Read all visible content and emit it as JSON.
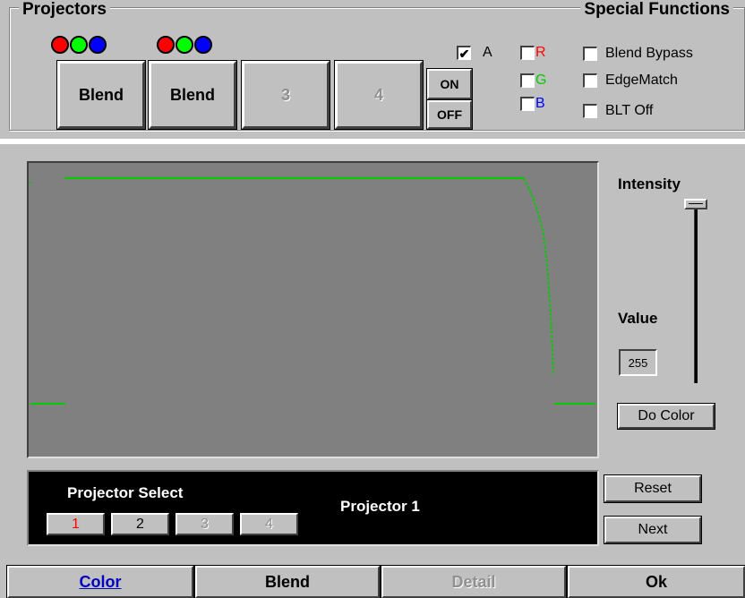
{
  "projectors_group": {
    "title": "Projectors",
    "projectors": [
      {
        "label": "Blend",
        "enabled": true,
        "has_rgb": true
      },
      {
        "label": "Blend",
        "enabled": true,
        "has_rgb": true
      },
      {
        "label": "3",
        "enabled": false,
        "has_rgb": false
      },
      {
        "label": "4",
        "enabled": false,
        "has_rgb": false
      }
    ],
    "on_label": "ON",
    "off_label": "OFF",
    "channels": {
      "a": {
        "label": "A",
        "checked": true
      },
      "r": {
        "label": "R",
        "checked": false,
        "color": "#ff0000"
      },
      "g": {
        "label": "G",
        "checked": false,
        "color": "#00cc00"
      },
      "b": {
        "label": "B",
        "checked": false,
        "color": "#0000ff"
      }
    }
  },
  "special_functions": {
    "title": "Special Functions",
    "options": [
      {
        "label": "Blend Bypass",
        "checked": false
      },
      {
        "label": "EdgeMatch",
        "checked": false
      },
      {
        "label": "BLT Off",
        "checked": false
      }
    ]
  },
  "intensity": {
    "title": "Intensity",
    "value_label": "Value",
    "value": "255",
    "slider_level": 1.0,
    "do_color_label": "Do Color"
  },
  "projector_select": {
    "title": "Projector Select",
    "buttons": [
      {
        "label": "1",
        "enabled": true,
        "selected": true
      },
      {
        "label": "2",
        "enabled": true,
        "selected": false
      },
      {
        "label": "3",
        "enabled": false,
        "selected": false
      },
      {
        "label": "4",
        "enabled": false,
        "selected": false
      }
    ],
    "current": "Projector 1"
  },
  "actions": {
    "reset_label": "Reset",
    "next_label": "Next"
  },
  "tabs": [
    {
      "label": "Color",
      "state": "active"
    },
    {
      "label": "Blend",
      "state": "enabled"
    },
    {
      "label": "Detail",
      "state": "disabled"
    },
    {
      "label": "Ok",
      "state": "enabled"
    }
  ],
  "colors": {
    "curve": "#00cc00",
    "graph_bg": "#808080",
    "dot_red": "#ff0000",
    "dot_green": "#00ff00",
    "dot_blue": "#0000ff",
    "active_tab": "#0000c0"
  }
}
